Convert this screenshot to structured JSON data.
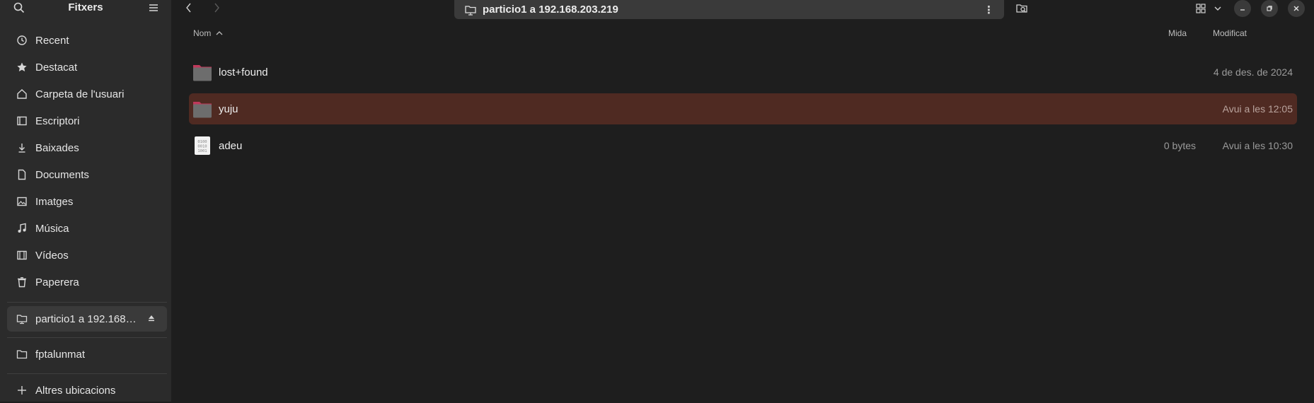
{
  "sidebar": {
    "title": "Fitxers",
    "items": [
      {
        "label": "Recent",
        "icon": "clock-icon"
      },
      {
        "label": "Destacat",
        "icon": "star-icon"
      },
      {
        "label": "Carpeta de l'usuari",
        "icon": "home-icon"
      },
      {
        "label": "Escriptori",
        "icon": "desktop-icon"
      },
      {
        "label": "Baixades",
        "icon": "download-icon"
      },
      {
        "label": "Documents",
        "icon": "document-icon"
      },
      {
        "label": "Imatges",
        "icon": "image-icon"
      },
      {
        "label": "Música",
        "icon": "music-icon"
      },
      {
        "label": "Vídeos",
        "icon": "video-icon"
      },
      {
        "label": "Paperera",
        "icon": "trash-icon"
      }
    ],
    "mount": {
      "label": "particio1 a 192.168…"
    },
    "bookmark": {
      "label": "fptalunmat"
    },
    "other": {
      "label": "Altres ubicacions"
    }
  },
  "pathbar": {
    "location": "particio1 a 192.168.203.219"
  },
  "columns": {
    "name": "Nom",
    "size": "Mida",
    "modified": "Modificat"
  },
  "files": [
    {
      "name": "lost+found",
      "size": "",
      "modified": "4 de des. de 2024",
      "type": "folder",
      "selected": false
    },
    {
      "name": "yuju",
      "size": "",
      "modified": "Avui a les 12:05",
      "type": "folder",
      "selected": true
    },
    {
      "name": "adeu",
      "size": "0 bytes",
      "modified": "Avui a les 10:30",
      "type": "binary-file",
      "selected": false
    }
  ],
  "colors": {
    "selection": "#4f2a22",
    "sidebar_bg": "#2b2b2b",
    "main_bg": "#1e1e1e",
    "folder": "#6d6d6d",
    "folder_tab": "#c0395b"
  }
}
